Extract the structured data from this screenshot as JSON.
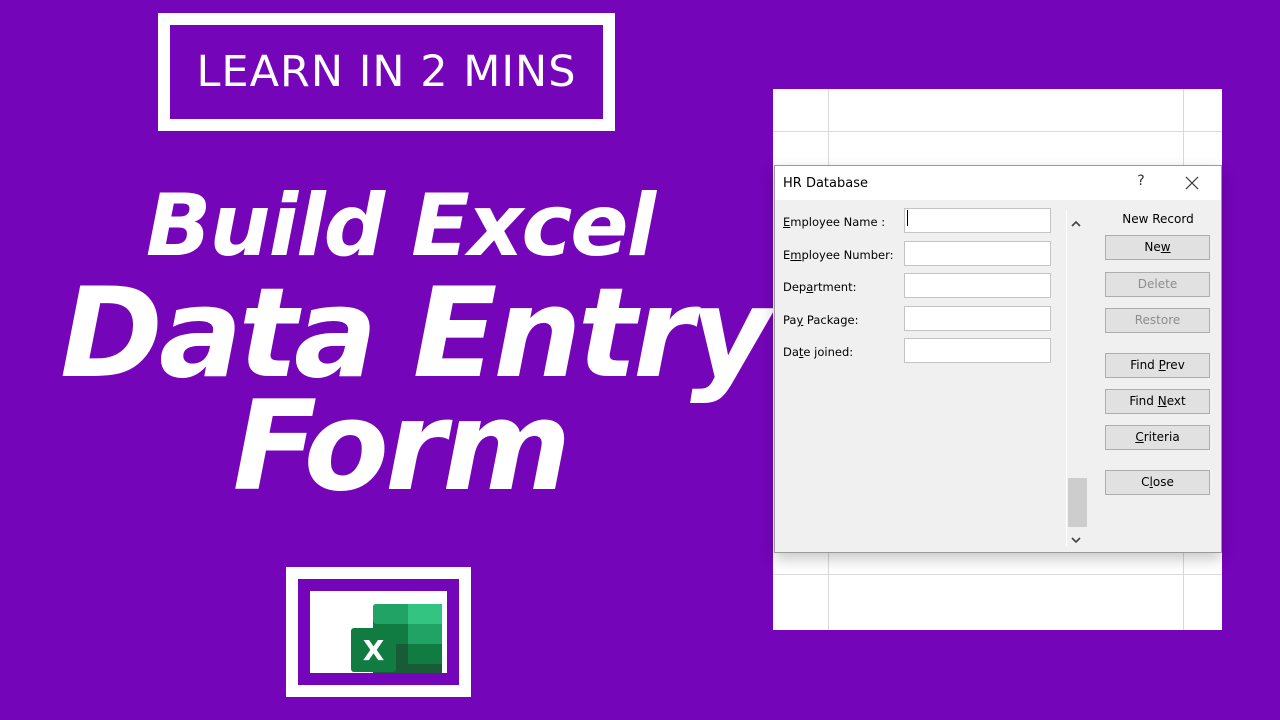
{
  "promo": {
    "badge": "LEARN IN 2 MINS",
    "headline_line1": "Build Excel",
    "headline_line2": "Data Entry",
    "headline_line3": "Form",
    "logo_icon": "excel-logo-icon",
    "background_color": "#7405b9"
  },
  "dialog": {
    "title": "HR Database",
    "help_label": "?",
    "close_icon": "close-icon",
    "record_status": "New Record",
    "fields": [
      {
        "label_pre": "",
        "label_key": "E",
        "label_post": "mployee Name :",
        "value": ""
      },
      {
        "label_pre": "E",
        "label_key": "m",
        "label_post": "ployee Number:",
        "value": ""
      },
      {
        "label_pre": "Dep",
        "label_key": "a",
        "label_post": "rtment:",
        "value": ""
      },
      {
        "label_pre": "Pa",
        "label_key": "y",
        "label_post": " Package:",
        "value": ""
      },
      {
        "label_pre": "Da",
        "label_key": "t",
        "label_post": "e joined:",
        "value": ""
      }
    ],
    "buttons": [
      {
        "pre": "Ne",
        "key": "w",
        "post": "",
        "enabled": true
      },
      {
        "pre": "",
        "key": "",
        "post": "Delete",
        "enabled": false
      },
      {
        "pre": "",
        "key": "",
        "post": "Restore",
        "enabled": false
      },
      {
        "pre": "Find ",
        "key": "P",
        "post": "rev",
        "enabled": true
      },
      {
        "pre": "Find ",
        "key": "N",
        "post": "ext",
        "enabled": true
      },
      {
        "pre": "",
        "key": "C",
        "post": "riteria",
        "enabled": true
      },
      {
        "pre": "C",
        "key": "l",
        "post": "ose",
        "enabled": true
      }
    ]
  }
}
